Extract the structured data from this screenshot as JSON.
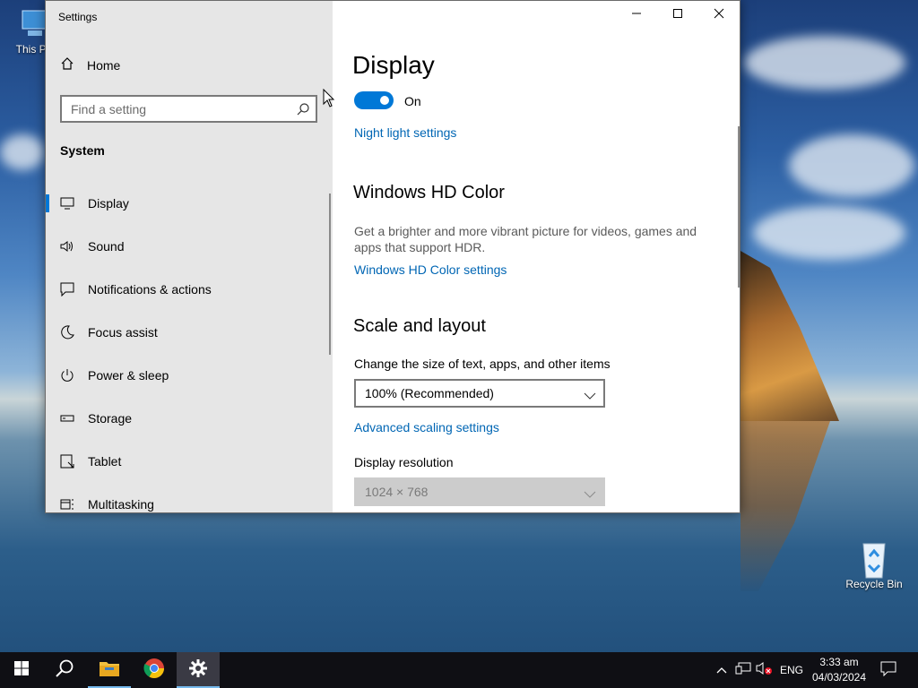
{
  "desktop": {
    "icons": [
      {
        "label": "This PC"
      },
      {
        "label": "Recycle Bin"
      }
    ]
  },
  "window": {
    "title": "Settings",
    "controls": {
      "minimize": "minimize-icon",
      "maximize": "maximize-icon",
      "close": "close-icon"
    }
  },
  "sidebar": {
    "home_label": "Home",
    "search_placeholder": "Find a setting",
    "section_title": "System",
    "items": [
      {
        "label": "Display",
        "icon": "monitor-icon",
        "active": true
      },
      {
        "label": "Sound",
        "icon": "speaker-icon"
      },
      {
        "label": "Notifications & actions",
        "icon": "message-icon"
      },
      {
        "label": "Focus assist",
        "icon": "moon-icon"
      },
      {
        "label": "Power & sleep",
        "icon": "power-icon"
      },
      {
        "label": "Storage",
        "icon": "storage-icon"
      },
      {
        "label": "Tablet",
        "icon": "tablet-icon"
      },
      {
        "label": "Multitasking",
        "icon": "multitasking-icon"
      }
    ]
  },
  "main": {
    "title": "Display",
    "night_light_toggle_state": "On",
    "night_light_link": "Night light settings",
    "hd_color": {
      "heading": "Windows HD Color",
      "description": "Get a brighter and more vibrant picture for videos, games and apps that support HDR.",
      "link": "Windows HD Color settings"
    },
    "scale": {
      "heading": "Scale and layout",
      "size_label": "Change the size of text, apps, and other items",
      "size_value": "100% (Recommended)",
      "advanced_link": "Advanced scaling settings",
      "resolution_label": "Display resolution",
      "resolution_value": "1024 × 768"
    }
  },
  "taskbar": {
    "apps": [
      {
        "icon": "windows-start-icon"
      },
      {
        "icon": "search-icon"
      },
      {
        "icon": "file-explorer-icon"
      },
      {
        "icon": "chrome-icon"
      },
      {
        "icon": "settings-gear-icon",
        "active": true
      }
    ],
    "tray": {
      "language": "ENG",
      "time": "3:33 am",
      "date": "04/03/2024"
    }
  },
  "colors": {
    "accent": "#0078d7",
    "link": "#0066b4",
    "sidebar_bg": "#e6e6e6",
    "taskbar_bg": "#0f0f14"
  }
}
